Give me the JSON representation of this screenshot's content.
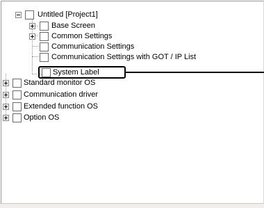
{
  "tree": {
    "root": {
      "label": "Untitled [Project1]"
    },
    "project_children": [
      {
        "label": "Base Screen"
      },
      {
        "label": "Common Settings"
      },
      {
        "label": "Communication Settings"
      },
      {
        "label": "Communication Settings with GOT / IP List"
      },
      {
        "label": "System Label"
      }
    ],
    "top_level": [
      {
        "label": "Standard monitor OS"
      },
      {
        "label": "Communication driver"
      },
      {
        "label": "Extended function OS"
      },
      {
        "label": "Option OS"
      }
    ]
  }
}
